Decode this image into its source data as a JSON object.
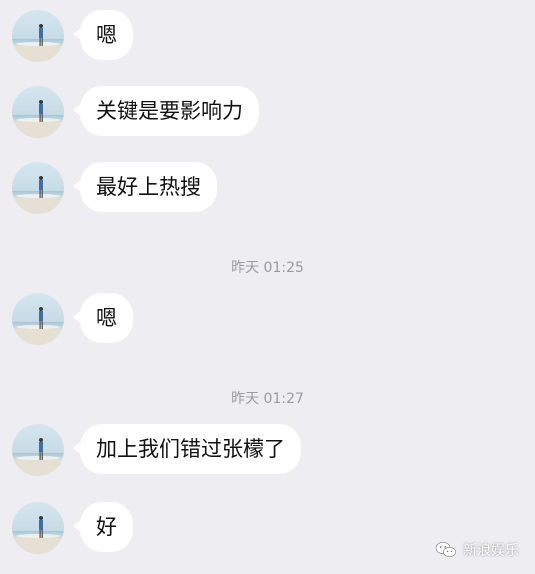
{
  "messages": [
    {
      "text": "嗯"
    },
    {
      "text": "关键是要影响力"
    },
    {
      "text": "最好上热搜"
    },
    {
      "timestamp": "昨天 01:25"
    },
    {
      "text": "嗯"
    },
    {
      "timestamp": "昨天 01:27"
    },
    {
      "text": "加上我们错过张檬了"
    },
    {
      "text": "好"
    }
  ],
  "watermark": {
    "text": "新浪娱乐",
    "icon": "wechat-icon"
  },
  "colors": {
    "background": "#ededf2",
    "bubble": "#ffffff",
    "timestamp": "#9a9aa0"
  }
}
